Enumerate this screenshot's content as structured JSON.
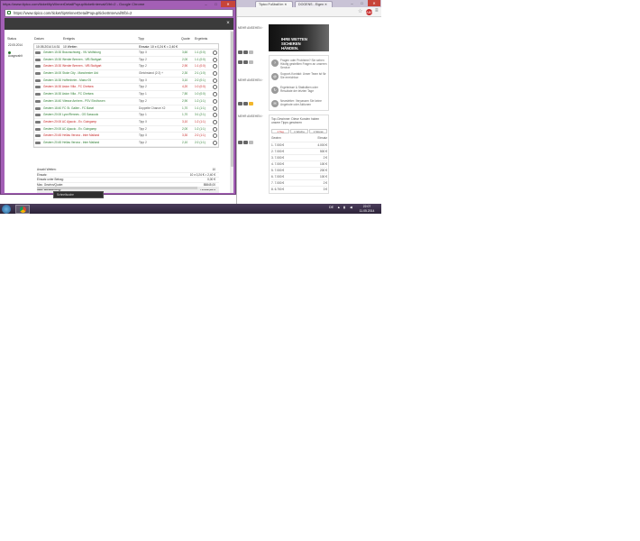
{
  "popup": {
    "window_title": "https://www.tipico.com/ticket/tipWinnerDetailPopup/ticketInterval/0/bl=2 - Google Chrome",
    "address": "https://www.tipico.com/ticket/tipWinnerDetailPopup/ticketInterval/0/bl=2",
    "controls": {
      "minimize": "–",
      "maximize": "□",
      "close": "✕"
    },
    "columns": {
      "status": "Status",
      "datum": "Datum",
      "ereignis": "Ereignis",
      "tipp": "Tipp",
      "quote": "Quote",
      "ergebnis": "Ergebnis"
    },
    "ticket_info": {
      "date": "22.05.2014",
      "state": "Ausgezahlt"
    },
    "ticket_header": {
      "date": "10.05.2014 14:31",
      "type": "10 Wetten",
      "einsatz": "Einsatz: 10 x 0,24 € = 2,40 €"
    },
    "bets": [
      {
        "event": "Gestern 15:30 Braunschweig - VfL Wolfsburg",
        "tip": "Tipp X",
        "quote": "3,60",
        "result": "1:1 (0:0)",
        "color": "#2e7d32"
      },
      {
        "event": "Gestern 15:30 Werder Bremen - VfB Stuttgart",
        "tip": "Tipp 2",
        "quote": "2,00",
        "result": "1:1 (0:0)",
        "color": "#2e7d32"
      },
      {
        "event": "Gestern 15:30 Werder Bremen - VfB Stuttgart",
        "tip": "Tipp 2",
        "quote": "2,90",
        "result": "1:1 (0:0)",
        "color": "#c62828"
      },
      {
        "event": "Gestern 16:00 Stoke City - Manchester Utd",
        "tip": "Gleichstand (2:2) +",
        "quote": "2,30",
        "result": "2:1 (1:0)",
        "color": "#2e7d32"
      },
      {
        "event": "Gestern 16:30 Hoffenheim - Mainz 05",
        "tip": "Tipp X",
        "quote": "3,10",
        "result": "2:2 (0:1)",
        "color": "#2e7d32"
      },
      {
        "event": "Gestern 16:30 Aston Villa - FC Chelsea",
        "tip": "Tipp 2",
        "quote": "4,20",
        "result": "1:0 (0:0)",
        "color": "#c62828"
      },
      {
        "event": "Gestern 16:30 Aston Villa - FC Chelsea",
        "tip": "Tipp 1",
        "quote": "7,50",
        "result": "1:0 (0:0)",
        "color": "#2e7d32"
      },
      {
        "event": "Gestern 16:40 Vitesse Arnhem - PSV Eindhoven",
        "tip": "Tipp 2",
        "quote": "2,90",
        "result": "1:2 (1:1)",
        "color": "#2e7d32"
      },
      {
        "event": "Gestern 18:40 FC St. Gallen - FC Basel",
        "tip": "Doppelte Chance X2",
        "quote": "1,70",
        "result": "1:1 (1:1)",
        "color": "#2e7d32"
      },
      {
        "event": "Gestern 20:00 Lyon/Rennes - OS Sassuolo",
        "tip": "Tipp 1",
        "quote": "1,70",
        "result": "3:1 (2:1)",
        "color": "#2e7d32"
      },
      {
        "event": "Gestern 20:00 AC Ajaccio - Ev. Guingamp",
        "tip": "Tipp X",
        "quote": "3,10",
        "result": "1:2 (1:1)",
        "color": "#c62828"
      },
      {
        "event": "Gestern 20:00 AC Ajaccio - Ev. Guingamp",
        "tip": "Tipp 2",
        "quote": "2,00",
        "result": "1:2 (1:1)",
        "color": "#2e7d32"
      },
      {
        "event": "Gestern 20:45 Hellas Verona - Inter Mailand",
        "tip": "Tipp X",
        "quote": "3,30",
        "result": "2:2 (1:1)",
        "color": "#c62828"
      },
      {
        "event": "Gestern 20:45 Hellas Verona - Inter Mailand",
        "tip": "Tipp 2",
        "quote": "2,10",
        "result": "2:2 (1:1)",
        "color": "#2e7d32"
      }
    ],
    "summary": [
      {
        "label": "Anzahl Wetten:",
        "value": "10",
        "bold": false
      },
      {
        "label": "Einsatz:",
        "value": "10 x 0,24 € = 2,40 €",
        "bold": false
      },
      {
        "label": "Einsatz unter Betrag:",
        "value": "0,00 €",
        "bold": false
      },
      {
        "label": "Max. Gewinn/Quote:",
        "value": "85845,00",
        "bold": false
      },
      {
        "label": "Max. Auszahlung:",
        "value": "76.092,34 €",
        "bold": true
      }
    ],
    "notification": "Schnellsuche"
  },
  "background": {
    "tabs": [
      "Tipico Fußball Im ✕",
      "DOGENS - Eigen ✕"
    ],
    "winctl": {
      "minimize": "–",
      "maximize": "□",
      "close": "✕"
    },
    "toolbar": {
      "star": "☆",
      "abp": "ABP",
      "menu": "≡"
    },
    "bet_labels": [
      "MEHR ANSEHEN ›",
      "MEHR ANSEHEN ›",
      "MEHR ANSEHEN ›",
      "MEHR ANSEHEN ›"
    ],
    "promo": "IHRE WETTEN SICHEREN HÄNDEN.",
    "info_items": [
      {
        "icon": "?",
        "text": "Fragen oder Probleme? Sie sehen Häufig gestellten Fragen an unseren Service"
      },
      {
        "icon": "@",
        "text": "Support-Kontakt: Unser Team ist für Sie erreichbar"
      },
      {
        "icon": "↻",
        "text": "Ergebnisse & Statistiken oder Resultate der letzten Tage"
      },
      {
        "icon": "✉",
        "text": "Newsletter: Verpassen Sie keine Angebote oder Aktionen"
      }
    ],
    "top_title": "Top-Gewinner: Diese Kunden haben unsere Tipps gewinnen",
    "top_tabs": [
      "1 Tag",
      "1 Woche",
      "1 Monat"
    ],
    "top_head": {
      "left": "Gewinn",
      "right": "Einsatz"
    },
    "top_rows": [
      {
        "rank": "1.",
        "win": "7.000 €",
        "stake": "4.000 €"
      },
      {
        "rank": "2.",
        "win": "7.000 €",
        "stake": "500 €"
      },
      {
        "rank": "3.",
        "win": "7.000 €",
        "stake": "2 €"
      },
      {
        "rank": "4.",
        "win": "7.000 €",
        "stake": "100 €"
      },
      {
        "rank": "5.",
        "win": "7.000 €",
        "stake": "200 €"
      },
      {
        "rank": "6.",
        "win": "7.000 €",
        "stake": "100 €"
      },
      {
        "rank": "7.",
        "win": "7.000 €",
        "stake": "2 €"
      },
      {
        "rank": "8.",
        "win": "6.700 €",
        "stake": "3 €"
      }
    ]
  },
  "taskbar": {
    "tray": "DE",
    "time": "22:07",
    "date": "11.05.2014"
  }
}
